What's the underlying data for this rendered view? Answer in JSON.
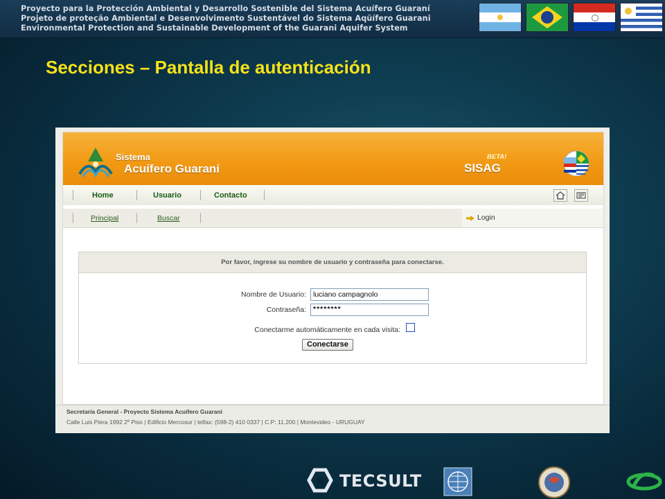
{
  "banner": {
    "lines": [
      "Proyecto para la Protección Ambiental y Desarrollo Sostenible del Sistema Acuífero Guaraní",
      "Projeto de proteção Ambiental e Desenvolvimento Sustentável do Sistema Aqüífero Guarani",
      "Environmental Protection and Sustainable Development of the Guarani Aquifer System"
    ],
    "flags": [
      "argentina-flag",
      "brazil-flag",
      "paraguay-flag",
      "uruguay-flag"
    ]
  },
  "slide": {
    "title": "Secciones – Pantalla de autenticación"
  },
  "site": {
    "logo_small": "Sistema",
    "logo_big": "Acuífero Guaraní",
    "beta": "BETA!",
    "brand": "SISAG",
    "nav_main": [
      {
        "label": "Home"
      },
      {
        "label": "Usuario"
      },
      {
        "label": "Contacto"
      }
    ],
    "nav_icons": [
      "home-icon",
      "mail-icon"
    ],
    "nav_sub": [
      {
        "label": "Principal"
      },
      {
        "label": "Buscar"
      }
    ],
    "login_link": "Login",
    "form": {
      "header": "Por favor, ingrese su nombre de usuario y contraseña para conectarse.",
      "username_label": "Nombre de Usuario:",
      "username_value": "luciano campagnolo",
      "password_label": "Contraseña:",
      "password_value": "********",
      "autologin_label": "Conectarme automáticamente en cada visita:",
      "autologin_checked": false,
      "submit_label": "Conectarse"
    },
    "footer": {
      "line1": "Secretaría General - Proyecto Sistema Acuífero Guaraní",
      "line2": "Calle Luis Piera 1992 2º Piso   |   Edificio Mercosur   |   telfax: (598-2) 410 0337   |   C.P: 11.200   |   Montevideo - URUGUAY"
    }
  },
  "bottom": {
    "tecsult": "TECSULT"
  },
  "colors": {
    "title_yellow": "#f7e21a",
    "header_orange": "#f29a14",
    "nav_green": "#1a5a14"
  }
}
